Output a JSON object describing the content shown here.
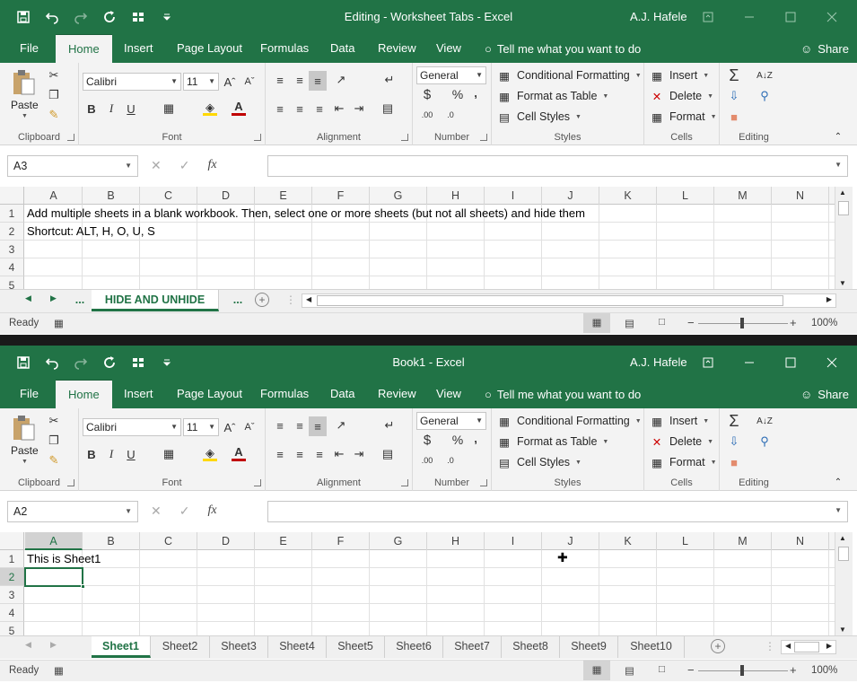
{
  "app": {
    "title_sep": " - ",
    "app_name": "Excel"
  },
  "windows": [
    {
      "doc_title": "Editing - Worksheet Tabs - Excel",
      "user": "A.J. Hafele",
      "name_box": "A3",
      "cells": {
        "a1": "Add multiple sheets in a blank workbook.  Then, select one or more sheets (but not all sheets) and hide them",
        "a2": "Shortcut: ALT, H, O, U, S"
      },
      "sheet_tabs": [
        "...",
        "HIDE AND UNHIDE",
        "..."
      ],
      "active_sheet": "HIDE AND UNHIDE",
      "status": "Ready",
      "zoom": "100%"
    },
    {
      "doc_title": "Book1 - Excel",
      "user": "A.J. Hafele",
      "name_box": "A2",
      "cells": {
        "a1": "This is Sheet1"
      },
      "sheet_tabs": [
        "Sheet1",
        "Sheet2",
        "Sheet3",
        "Sheet4",
        "Sheet5",
        "Sheet6",
        "Sheet7",
        "Sheet8",
        "Sheet9",
        "Sheet10"
      ],
      "active_sheet": "Sheet1",
      "status": "Ready",
      "zoom": "100%"
    }
  ],
  "ribbon_tabs": [
    "File",
    "Home",
    "Insert",
    "Page Layout",
    "Formulas",
    "Data",
    "Review",
    "View"
  ],
  "tell_me": "Tell me what you want to do",
  "share": "Share",
  "groups": {
    "clipboard": {
      "label": "Clipboard",
      "paste": "Paste"
    },
    "font": {
      "label": "Font",
      "font_name": "Calibri",
      "font_size": "11",
      "bold": "B",
      "italic": "I",
      "underline": "U"
    },
    "alignment": {
      "label": "Alignment"
    },
    "number": {
      "label": "Number",
      "format": "General",
      "currency": "$",
      "percent": "%",
      "comma": ","
    },
    "styles": {
      "label": "Styles",
      "cond_format": "Conditional Formatting",
      "format_table": "Format as Table",
      "cell_styles": "Cell Styles"
    },
    "cells": {
      "label": "Cells",
      "insert": "Insert",
      "delete": "Delete",
      "format": "Format"
    },
    "editing": {
      "label": "Editing"
    }
  },
  "columns": [
    "A",
    "B",
    "C",
    "D",
    "E",
    "F",
    "G",
    "H",
    "I",
    "J",
    "K",
    "L",
    "M",
    "N"
  ],
  "rows": [
    "1",
    "2",
    "3",
    "4",
    "5"
  ],
  "fx": "fx",
  "colors": {
    "excel_green": "#217346",
    "ribbon_bg": "#f3f3f3"
  }
}
